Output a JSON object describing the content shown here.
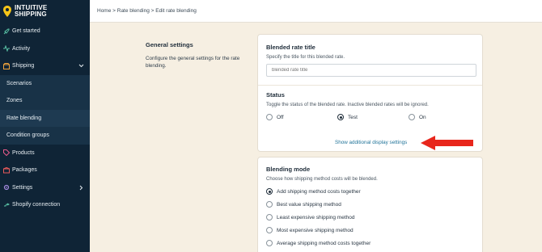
{
  "brand": {
    "line1": "INTUITIVE",
    "line2": "SHIPPING"
  },
  "sidebar": {
    "items": [
      {
        "label": "Get started",
        "icon": "rocket-icon"
      },
      {
        "label": "Activity",
        "icon": "activity-icon"
      },
      {
        "label": "Shipping",
        "icon": "box-icon"
      },
      {
        "label": "Scenarios"
      },
      {
        "label": "Zones"
      },
      {
        "label": "Rate blending"
      },
      {
        "label": "Condition groups"
      },
      {
        "label": "Products",
        "icon": "tag-icon"
      },
      {
        "label": "Packages",
        "icon": "package-icon"
      },
      {
        "label": "Settings",
        "icon": "gear-icon"
      },
      {
        "label": "Shopify connection",
        "icon": "link-icon"
      }
    ]
  },
  "breadcrumb": "Home > Rate blending > Edit rate blending",
  "general": {
    "title": "General settings",
    "description": "Configure the general settings for the rate blending."
  },
  "card1": {
    "title": "Blended rate title",
    "subtitle": "Specify the title for this blended rate.",
    "input_placeholder": "blended rate title",
    "status_title": "Status",
    "status_subtitle": "Toggle the status of the blended rate. Inactive blended rates will be ignored.",
    "status_options": [
      "Off",
      "Test",
      "On"
    ],
    "status_selected": "Test",
    "link_text": "Show additional display settings"
  },
  "card2": {
    "title": "Blending mode",
    "subtitle": "Choose how shipping method costs will be blended.",
    "options": [
      "Add shipping method costs together",
      "Best value shipping method",
      "Least expensive shipping method",
      "Most expensive shipping method",
      "Average shipping method costs together"
    ],
    "selected": "Add shipping method costs together"
  },
  "colors": {
    "sidebar_bg": "#0f2436",
    "page_bg": "#f6efe2",
    "link": "#23759a",
    "arrow": "#e8261c"
  }
}
